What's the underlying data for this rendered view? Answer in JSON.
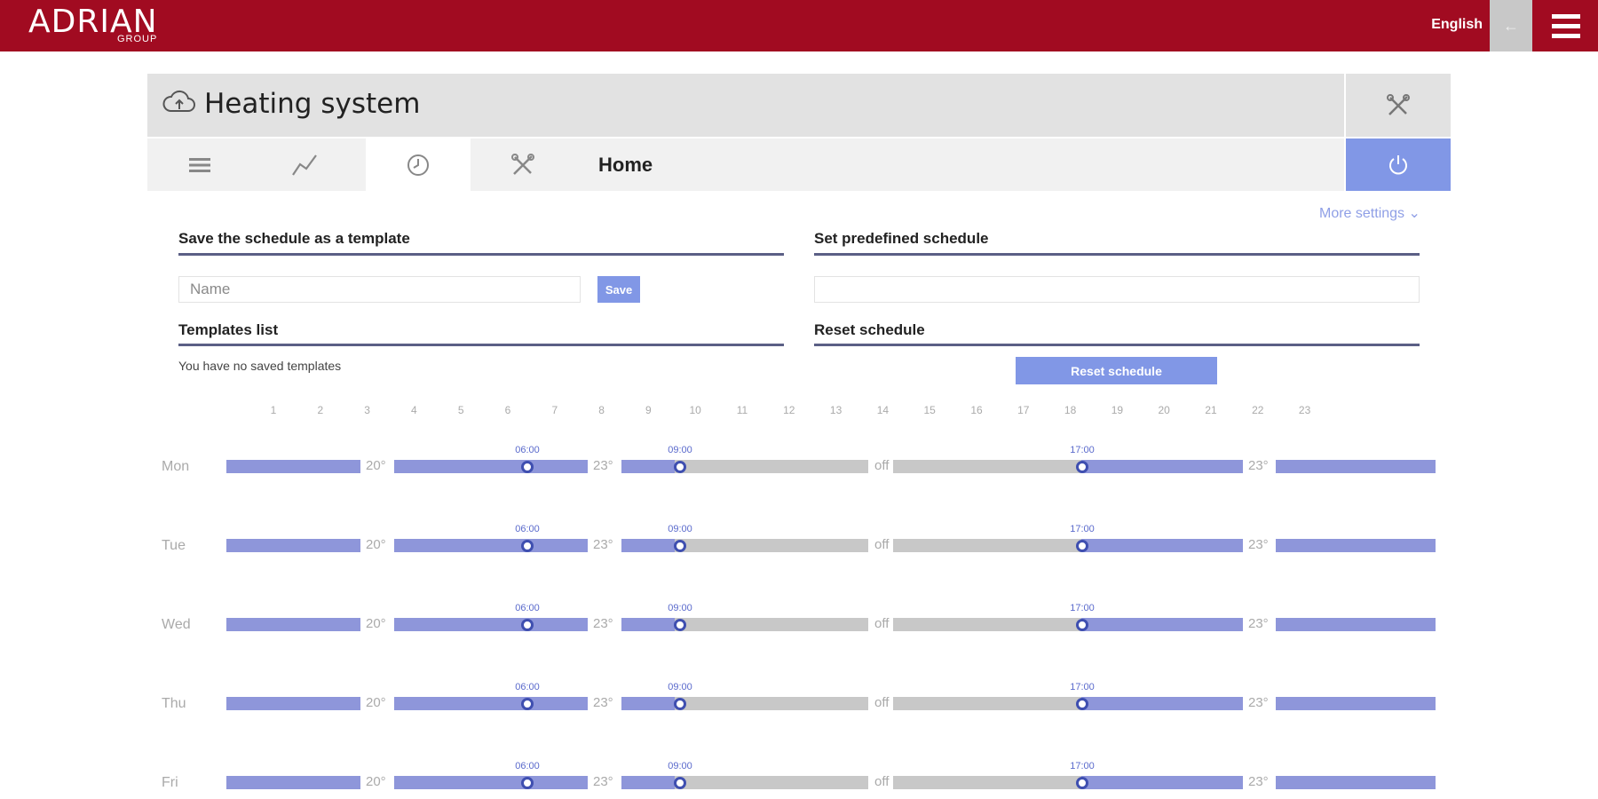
{
  "brand": {
    "name": "ADRIAN",
    "sub": "GROUP"
  },
  "header": {
    "language": "English",
    "back_label": "←"
  },
  "device": {
    "title": "Heating system",
    "mode": "Home"
  },
  "more_settings": "More settings",
  "sections": {
    "save_template": "Save the schedule as a template",
    "predefined": "Set predefined schedule",
    "templates_list": "Templates list",
    "reset": "Reset schedule"
  },
  "name_input": {
    "placeholder": "Name",
    "value": ""
  },
  "save_label": "Save",
  "no_templates": "You have no saved templates",
  "reset_label": "Reset schedule",
  "hours": [
    "1",
    "2",
    "3",
    "4",
    "5",
    "6",
    "7",
    "8",
    "9",
    "10",
    "11",
    "12",
    "13",
    "14",
    "15",
    "16",
    "17",
    "18",
    "19",
    "20",
    "21",
    "22",
    "23"
  ],
  "schedule": [
    {
      "day": "Mon",
      "times": [
        "06:00",
        "09:00",
        "17:00"
      ],
      "temps": [
        "20°",
        "23°",
        "off",
        "23°"
      ]
    },
    {
      "day": "Tue",
      "times": [
        "06:00",
        "09:00",
        "17:00"
      ],
      "temps": [
        "20°",
        "23°",
        "off",
        "23°"
      ]
    },
    {
      "day": "Wed",
      "times": [
        "06:00",
        "09:00",
        "17:00"
      ],
      "temps": [
        "20°",
        "23°",
        "off",
        "23°"
      ]
    },
    {
      "day": "Thu",
      "times": [
        "06:00",
        "09:00",
        "17:00"
      ],
      "temps": [
        "20°",
        "23°",
        "off",
        "23°"
      ]
    },
    {
      "day": "Fri",
      "times": [
        "06:00",
        "09:00",
        "17:00"
      ],
      "temps": [
        "20°",
        "23°",
        "off",
        "23°"
      ]
    }
  ],
  "colors": {
    "brand": "#a10b21",
    "accent": "#8197e6",
    "heat": "#8e96da",
    "off": "#c8c8c8"
  },
  "icons": {
    "cloud": "cloud-icon",
    "tools": "tools-icon",
    "list": "list-icon",
    "chart": "chart-icon",
    "clock": "clock-icon",
    "power": "power-icon",
    "menu": "menu-icon"
  }
}
